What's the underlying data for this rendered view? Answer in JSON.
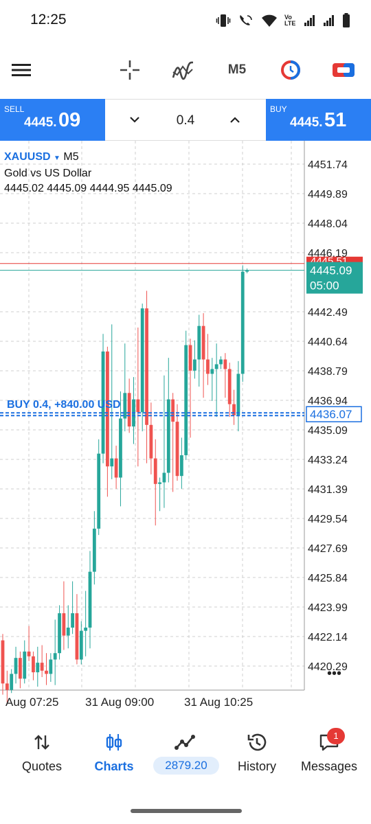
{
  "status_bar": {
    "time": "12:25",
    "icons": [
      "vibrate-icon",
      "wifi-calling-icon",
      "wifi-icon",
      "volte-icon",
      "signal-icon",
      "signal-icon",
      "battery-icon"
    ],
    "volte_text": "Vo LTE"
  },
  "toolbar": {
    "timeframe": "M5",
    "icons": [
      "menu-icon",
      "crosshair-icon",
      "indicators-icon",
      "timeframe",
      "one-click-trading-icon",
      "trade-icon"
    ]
  },
  "trade_panel": {
    "sell_label": "SELL",
    "sell_price_small": "4445.",
    "sell_price_big": "09",
    "buy_label": "BUY",
    "buy_price_small": "4445.",
    "buy_price_big": "51",
    "volume": "0.4"
  },
  "chart": {
    "symbol": "XAUUSD",
    "timeframe": "M5",
    "description": "Gold vs US Dollar",
    "ohlc": "4445.02 4445.09 4444.95 4445.09",
    "price_labels": [
      "4451.74",
      "4449.89",
      "4448.04",
      "4446.19",
      "4442.49",
      "4440.64",
      "4438.79",
      "4436.94",
      "4435.09",
      "4433.24",
      "4431.39",
      "4429.54",
      "4427.69",
      "4425.84",
      "4423.99",
      "4422.14",
      "4420.29"
    ],
    "time_labels": [
      "Aug 07:25",
      "31 Aug 09:00",
      "31 Aug 10:25"
    ],
    "bid_tag": "4445.09",
    "ask_tag": "4445.51",
    "timer_tag": "05:00",
    "position_tag": "4436.07",
    "position_label": "BUY 0.4, +840.00 USD",
    "overflow": "•••"
  },
  "chart_data": {
    "type": "candlestick",
    "symbol": "XAUUSD",
    "timeframe": "M5",
    "ylim": [
      4419.0,
      4453.0
    ],
    "grid": true,
    "candles": [
      [
        4421.9,
        4422.3,
        4418.5,
        4419.2
      ],
      [
        4419.2,
        4420.0,
        4418.0,
        4418.8
      ],
      [
        4418.8,
        4420.1,
        4418.6,
        4419.8
      ],
      [
        4419.8,
        4421.5,
        4419.2,
        4420.8
      ],
      [
        4420.8,
        4421.2,
        4418.9,
        4419.5
      ],
      [
        4419.5,
        4421.9,
        4419.2,
        4421.2
      ],
      [
        4421.2,
        4422.8,
        4420.6,
        4420.9
      ],
      [
        4420.9,
        4421.2,
        4419.4,
        4419.9
      ],
      [
        4419.9,
        4421.5,
        4419.0,
        4420.5
      ],
      [
        4420.5,
        4421.6,
        4419.6,
        4420.0
      ],
      [
        4420.0,
        4421.1,
        4419.1,
        4419.8
      ],
      [
        4419.8,
        4421.1,
        4419.3,
        4420.7
      ],
      [
        4420.7,
        4423.2,
        4419.1,
        4421.1
      ],
      [
        4421.1,
        4424.1,
        4420.7,
        4423.6
      ],
      [
        4423.6,
        4425.6,
        4421.3,
        4422.2
      ],
      [
        4422.2,
        4424.1,
        4421.4,
        4422.7
      ],
      [
        4422.7,
        4425.6,
        4422.3,
        4423.6
      ],
      [
        4423.6,
        4424.8,
        4420.4,
        4420.7
      ],
      [
        4420.7,
        4423.1,
        4420.4,
        4422.5
      ],
      [
        4422.5,
        4425.0,
        4420.9,
        4422.7
      ],
      [
        4422.7,
        4427.5,
        4421.4,
        4426.2
      ],
      [
        4426.2,
        4430.0,
        4425.4,
        4428.9
      ],
      [
        4428.9,
        4434.5,
        4428.5,
        4433.6
      ],
      [
        4433.6,
        4441.1,
        4433.0,
        4440.0
      ],
      [
        4440.0,
        4440.3,
        4430.9,
        4432.8
      ],
      [
        4432.8,
        4441.7,
        4432.0,
        4433.3
      ],
      [
        4433.3,
        4434.1,
        4431.4,
        4432.1
      ],
      [
        4432.1,
        4437.5,
        4430.3,
        4435.8
      ],
      [
        4435.8,
        4440.5,
        4435.0,
        4437.4
      ],
      [
        4437.4,
        4438.3,
        4434.9,
        4435.3
      ],
      [
        4435.3,
        4438.4,
        4434.2,
        4437.0
      ],
      [
        4437.0,
        4441.5,
        4432.8,
        4436.2
      ],
      [
        4436.2,
        4443.0,
        4435.0,
        4442.7
      ],
      [
        4442.7,
        4443.8,
        4433.0,
        4435.4
      ],
      [
        4435.4,
        4436.8,
        4432.3,
        4433.3
      ],
      [
        4433.3,
        4434.5,
        4429.1,
        4431.7
      ],
      [
        4431.7,
        4432.1,
        4430.0,
        4431.8
      ],
      [
        4431.8,
        4438.5,
        4430.2,
        4432.4
      ],
      [
        4432.4,
        4439.6,
        4431.8,
        4437.0
      ],
      [
        4437.0,
        4437.4,
        4431.2,
        4435.6
      ],
      [
        4435.6,
        4436.7,
        4431.9,
        4432.2
      ],
      [
        4432.2,
        4434.6,
        4431.4,
        4433.5
      ],
      [
        4433.5,
        4441.3,
        4433.2,
        4440.4
      ],
      [
        4440.4,
        4440.8,
        4434.6,
        4438.8
      ],
      [
        4438.8,
        4440.7,
        4438.3,
        4439.5
      ],
      [
        4439.5,
        4442.3,
        4437.8,
        4441.6
      ],
      [
        4441.6,
        4442.4,
        4437.1,
        4439.5
      ],
      [
        4439.5,
        4441.1,
        4437.9,
        4438.6
      ],
      [
        4438.6,
        4439.6,
        4436.9,
        4438.9
      ],
      [
        4438.9,
        4440.5,
        4435.9,
        4439.2
      ],
      [
        4439.2,
        4439.7,
        4438.9,
        4439.5
      ],
      [
        4439.5,
        4439.9,
        4437.1,
        4438.9
      ],
      [
        4438.9,
        4439.3,
        4435.9,
        4436.7
      ],
      [
        4436.7,
        4437.6,
        4435.4,
        4436.0
      ],
      [
        4436.0,
        4439.4,
        4435.0,
        4438.6
      ],
      [
        4438.6,
        4445.4,
        4438.1,
        4445.0
      ],
      [
        4445.0,
        4445.2,
        4444.9,
        4445.09
      ]
    ],
    "bid": 4445.09,
    "ask": 4445.51,
    "position": {
      "side": "BUY",
      "volume": 0.4,
      "price": 4436.07,
      "profit": "+840.00 USD"
    },
    "colors": {
      "bull": "#26a69a",
      "bear": "#ef5350",
      "ask_line": "#e53935",
      "bid_line": "#26a69a",
      "position_line": "#1a6fe0"
    }
  },
  "bottom_nav": {
    "items": [
      {
        "label": "Quotes",
        "icon": "quotes-icon"
      },
      {
        "label": "Charts",
        "icon": "charts-icon"
      },
      {
        "label": "",
        "icon": "trade-icon"
      },
      {
        "label": "History",
        "icon": "history-icon"
      },
      {
        "label": "Messages",
        "icon": "messages-icon"
      }
    ],
    "balance": "2879.20",
    "messages_badge": "1"
  }
}
